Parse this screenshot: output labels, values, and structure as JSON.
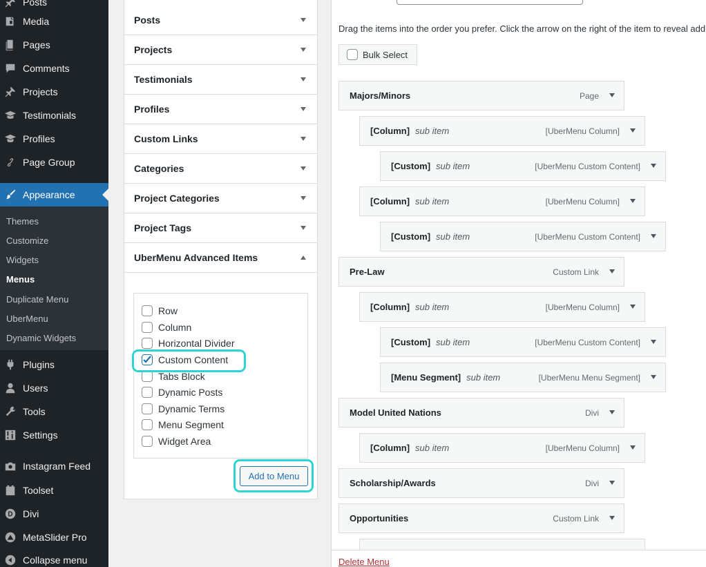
{
  "admin_menu": {
    "items": [
      {
        "label": "Posts",
        "icon": "thumbtack-icon"
      },
      {
        "label": "Media",
        "icon": "media-icon"
      },
      {
        "label": "Pages",
        "icon": "pages-icon"
      },
      {
        "label": "Comments",
        "icon": "comment-icon"
      },
      {
        "label": "Projects",
        "icon": "thumbtack-icon"
      },
      {
        "label": "Testimonials",
        "icon": "mortarboard-icon"
      },
      {
        "label": "Profiles",
        "icon": "mortarboard-icon"
      },
      {
        "label": "Page Group",
        "icon": "link-icon"
      },
      {
        "label": "Appearance",
        "icon": "paintbrush-icon"
      }
    ],
    "submenu": [
      "Themes",
      "Customize",
      "Widgets",
      "Menus",
      "Duplicate Menu",
      "UberMenu",
      "Dynamic Widgets"
    ],
    "items_after": [
      {
        "label": "Plugins",
        "icon": "plugin-icon"
      },
      {
        "label": "Users",
        "icon": "users-icon"
      },
      {
        "label": "Tools",
        "icon": "wrench-icon"
      },
      {
        "label": "Settings",
        "icon": "settings-icon"
      },
      {
        "label": "Instagram Feed",
        "icon": "camera-icon"
      },
      {
        "label": "Toolset",
        "icon": "toolset-icon"
      },
      {
        "label": "Divi",
        "icon": "divi-icon"
      },
      {
        "label": "MetaSlider Pro",
        "icon": "metaslider-icon"
      },
      {
        "label": "Collapse menu",
        "icon": "collapse-icon"
      }
    ]
  },
  "accordion": {
    "sections": [
      "Posts",
      "Projects",
      "Testimonials",
      "Profiles",
      "Custom Links",
      "Categories",
      "Project Categories",
      "Project Tags",
      "UberMenu Advanced Items"
    ],
    "checklist": [
      {
        "label": "Row",
        "checked": false
      },
      {
        "label": "Column",
        "checked": false
      },
      {
        "label": "Horizontal Divider",
        "checked": false
      },
      {
        "label": "Custom Content",
        "checked": true
      },
      {
        "label": "Tabs Block",
        "checked": false
      },
      {
        "label": "Dynamic Posts",
        "checked": false
      },
      {
        "label": "Dynamic Terms",
        "checked": false
      },
      {
        "label": "Menu Segment",
        "checked": false
      },
      {
        "label": "Widget Area",
        "checked": false
      }
    ],
    "add_button": "Add to Menu"
  },
  "menu_structure": {
    "instructions": "Drag the items into the order you prefer. Click the arrow on the right of the item to reveal additional configuration options.",
    "bulk_select": "Bulk Select",
    "sub_item_label": "sub item",
    "items": [
      {
        "title": "Majors/Minors",
        "type": "Page",
        "depth": 0,
        "sub": false
      },
      {
        "title": "[Column]",
        "type": "[UberMenu Column]",
        "depth": 1,
        "sub": true
      },
      {
        "title": "[Custom]",
        "type": "[UberMenu Custom Content]",
        "depth": 2,
        "sub": true
      },
      {
        "title": "[Column]",
        "type": "[UberMenu Column]",
        "depth": 1,
        "sub": true
      },
      {
        "title": "[Custom]",
        "type": "[UberMenu Custom Content]",
        "depth": 2,
        "sub": true
      },
      {
        "title": "Pre-Law",
        "type": "Custom Link",
        "depth": 0,
        "sub": false
      },
      {
        "title": "[Column]",
        "type": "[UberMenu Column]",
        "depth": 1,
        "sub": true
      },
      {
        "title": "[Custom]",
        "type": "[UberMenu Custom Content]",
        "depth": 2,
        "sub": true
      },
      {
        "title": "[Menu Segment]",
        "type": "[UberMenu Menu Segment]",
        "depth": 2,
        "sub": true
      },
      {
        "title": "Model United Nations",
        "type": "Divi",
        "depth": 0,
        "sub": false
      },
      {
        "title": "[Column]",
        "type": "[UberMenu Column]",
        "depth": 1,
        "sub": true
      },
      {
        "title": "Scholarship/Awards",
        "type": "Divi",
        "depth": 0,
        "sub": false
      },
      {
        "title": "Opportunities",
        "type": "Custom Link",
        "depth": 0,
        "sub": false
      }
    ],
    "delete_link": "Delete Menu"
  },
  "colors": {
    "sidebar_bg": "#1d2327",
    "accent": "#2271b1",
    "highlight": "#2ed3d3",
    "delete": "#b32d2e"
  }
}
